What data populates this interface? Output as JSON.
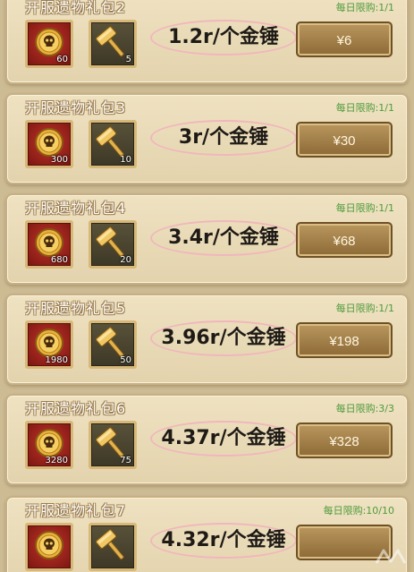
{
  "packs": [
    {
      "title": "开服遗物礼包2",
      "limit": "每日限购:1/1",
      "coin_qty": "60",
      "hammer_qty": "5",
      "unit_price": "1.2r/个金锤",
      "price": "¥6"
    },
    {
      "title": "开服遗物礼包3",
      "limit": "每日限购:1/1",
      "coin_qty": "300",
      "hammer_qty": "10",
      "unit_price": "3r/个金锤",
      "price": "¥30"
    },
    {
      "title": "开服遗物礼包4",
      "limit": "每日限购:1/1",
      "coin_qty": "680",
      "hammer_qty": "20",
      "unit_price": "3.4r/个金锤",
      "price": "¥68"
    },
    {
      "title": "开服遗物礼包5",
      "limit": "每日限购:1/1",
      "coin_qty": "1980",
      "hammer_qty": "50",
      "unit_price": "3.96r/个金锤",
      "price": "¥198"
    },
    {
      "title": "开服遗物礼包6",
      "limit": "每日限购:3/3",
      "coin_qty": "3280",
      "hammer_qty": "75",
      "unit_price": "4.37r/个金锤",
      "price": "¥328"
    },
    {
      "title": "开服遗物礼包7",
      "limit": "每日限购:10/10",
      "coin_qty": "",
      "hammer_qty": "",
      "unit_price": "4.32r/个金锤",
      "price": ""
    }
  ],
  "icons": {
    "coin": "skull-coin-icon",
    "hammer": "golden-hammer-icon"
  },
  "colors": {
    "limit_text": "#4e9a3c",
    "coin_box": "#a82a20",
    "hammer_box": "#4a4430",
    "price_highlight": "#f1b6bd",
    "button": "#a07e47"
  }
}
